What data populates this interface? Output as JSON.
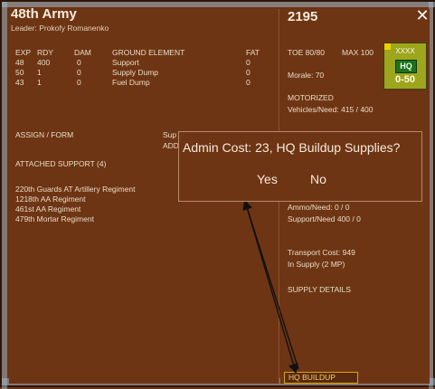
{
  "header": {
    "army_name": "48th Army",
    "leader": "Leader: Prokofy Romanenko",
    "turn": "2195",
    "close_icon": "close-icon"
  },
  "ground_elements": {
    "columns": [
      "EXP",
      "RDY",
      "DAM",
      "GROUND ELEMENT",
      "FAT"
    ],
    "rows": [
      {
        "exp": "48",
        "rdy": "400",
        "dam": "0",
        "name": "Support",
        "fat": "0"
      },
      {
        "exp": "50",
        "rdy": "1",
        "dam": "0",
        "name": "Supply Dump",
        "fat": "0"
      },
      {
        "exp": "43",
        "rdy": "1",
        "dam": "0",
        "name": "Fuel Dump",
        "fat": "0"
      }
    ]
  },
  "assign_form": "ASSIGN / FORM",
  "partial_left": {
    "sup": "Sup",
    "add": "ADD"
  },
  "attached_support": {
    "title": "ATTACHED SUPPORT  (4)",
    "items": [
      "220th Guards AT Artillery Regiment",
      "1218th AA Regiment",
      "461st AA Regiment",
      "479th Mortar Regiment"
    ]
  },
  "stats": {
    "toe": "TOE 80/80",
    "max": "MAX 100",
    "morale": "Morale:  70",
    "motorized": "MOTORIZED",
    "vehicles": "Vehicles/Need:  415 / 400",
    "ammo": "Ammo/Need:  0 / 0",
    "support": "Support/Need   400 / 0",
    "transport": "Transport Cost:     949",
    "in_supply": "In Supply (2 MP)",
    "supply_details": "SUPPLY DETAILS",
    "hq_buildup": "HQ BUILDUP"
  },
  "counter": {
    "size": "XXXX",
    "type": "HQ",
    "strength": "0-50",
    "color": "#9da61c"
  },
  "dialog": {
    "message": "Admin Cost: 23, HQ Buildup Supplies?",
    "yes": "Yes",
    "no": "No"
  }
}
